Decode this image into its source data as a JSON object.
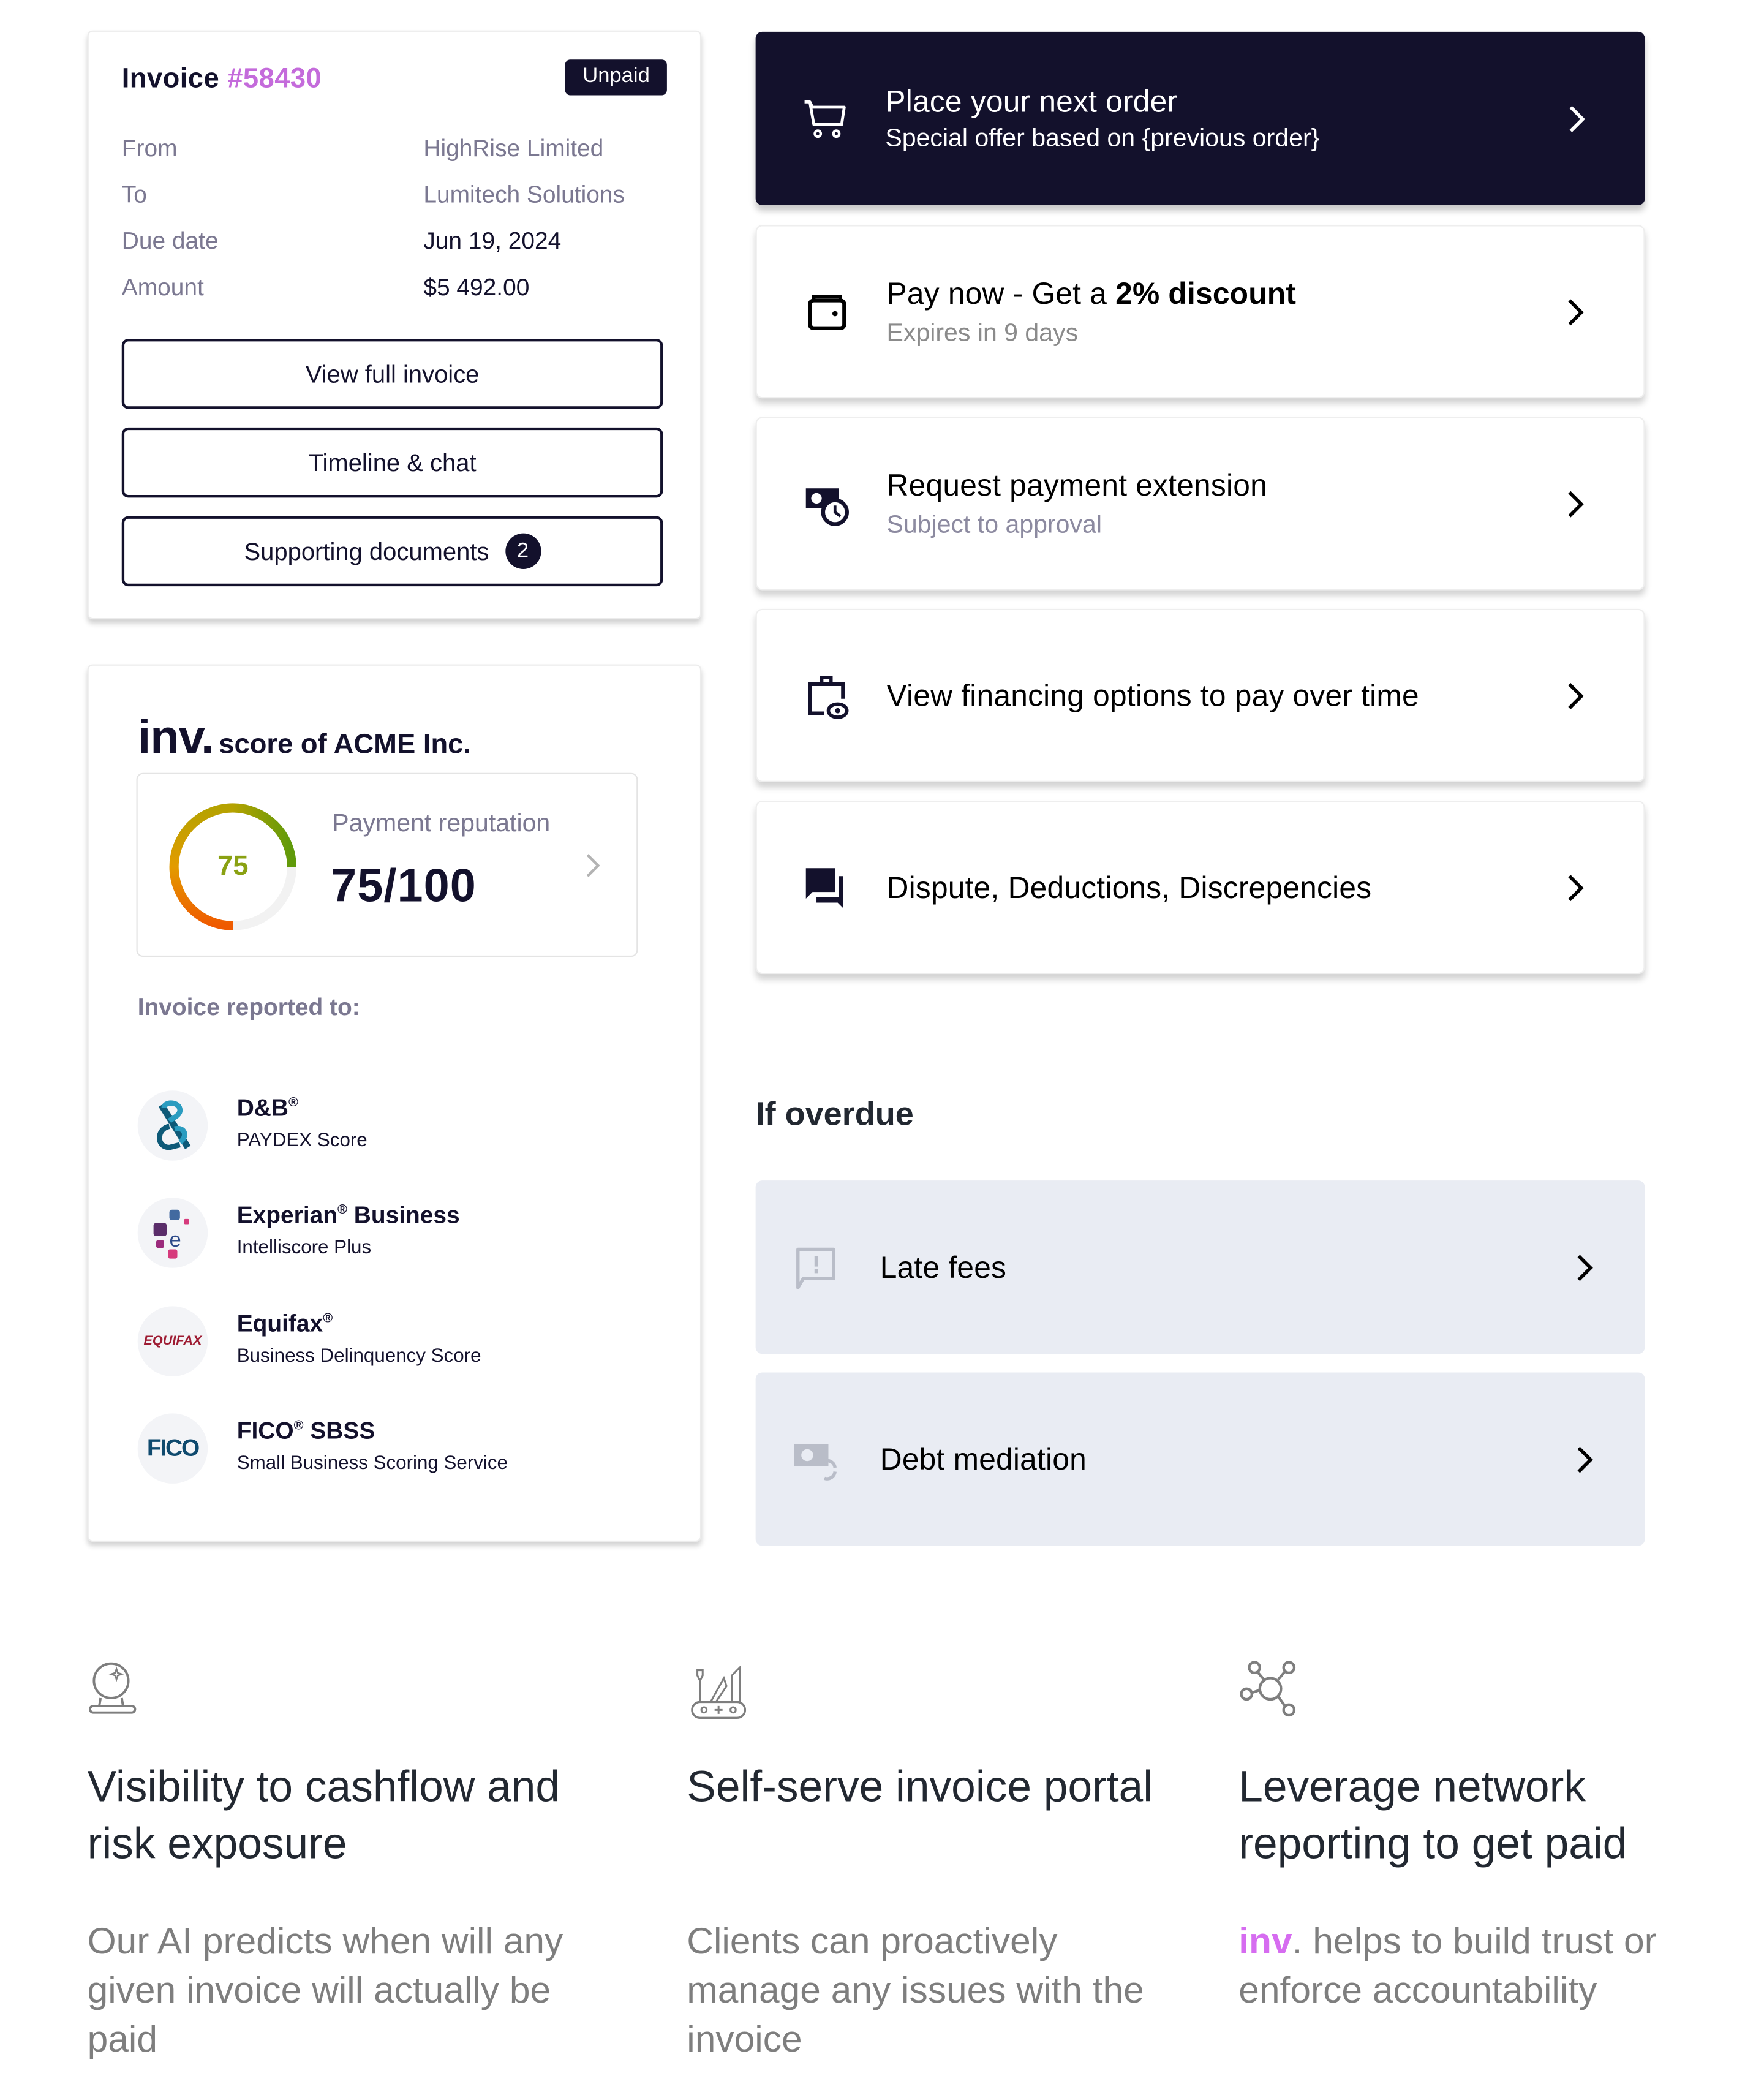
{
  "invoice": {
    "title_prefix": "Invoice",
    "number": "#58430",
    "status": "Unpaid",
    "fields": [
      {
        "label": "From",
        "value": "HighRise Limited"
      },
      {
        "label": "To",
        "value": "Lumitech Solutions"
      },
      {
        "label": "Due date",
        "value": "Jun 19, 2024"
      },
      {
        "label": "Amount",
        "value": "$5 492.00"
      }
    ],
    "buttons": {
      "view_full": "View full invoice",
      "timeline": "Timeline & chat",
      "supporting_docs": "Supporting documents",
      "supporting_docs_count": "2"
    },
    "colors": {
      "number": "#c46bdb",
      "dark": "#13112c"
    }
  },
  "score": {
    "brand": "inv.",
    "heading_rest": "score of ACME Inc.",
    "reputation_label": "Payment reputation",
    "score_value": 75,
    "score_max": 100,
    "score_display": "75/100",
    "gauge_number": "75",
    "reported_label": "Invoice reported to:",
    "bureaus": [
      {
        "name": "D&B",
        "reg": "®",
        "subtitle": "PAYDEX Score",
        "logo": "dnb-logo"
      },
      {
        "name": "Experian",
        "reg": "®",
        "name_suffix": " Business",
        "subtitle": "Intelliscore Plus",
        "logo": "experian-logo"
      },
      {
        "name": "Equifax",
        "reg": "®",
        "subtitle": "Business Delinquency Score",
        "logo": "equifax-logo",
        "logo_text": "EQUIFAX"
      },
      {
        "name": "FICO",
        "reg": "®",
        "name_suffix": " SBSS",
        "subtitle": "Small Business Scoring Service",
        "logo": "fico-logo",
        "logo_text": "FICO"
      }
    ]
  },
  "actions": [
    {
      "title": "Place your next order",
      "subtitle": "Special offer based on {previous order}",
      "icon": "cart-icon",
      "style": "dark"
    },
    {
      "title_plain": "Pay now - Get a ",
      "title_bold": "2% discount",
      "subtitle": "Expires in 9 days",
      "icon": "wallet-icon",
      "style": "light"
    },
    {
      "title": "Request payment extension",
      "subtitle": "Subject to approval",
      "icon": "money-clock-icon",
      "style": "light"
    },
    {
      "title": "View financing options to pay over time",
      "icon": "briefcase-eye-icon",
      "style": "light"
    },
    {
      "title": "Dispute, Deductions, Discrepencies",
      "icon": "chat-bubbles-icon",
      "style": "light"
    }
  ],
  "overdue": {
    "title": "If overdue",
    "items": [
      {
        "title": "Late fees",
        "icon": "alert-comment-icon"
      },
      {
        "title": "Debt mediation",
        "icon": "money-sync-icon"
      }
    ]
  },
  "features": [
    {
      "icon": "crystal-ball-icon",
      "heading": "Visibility to cashflow and risk exposure",
      "body": "Our AI predicts when will any given invoice will actually be paid"
    },
    {
      "icon": "swiss-knife-icon",
      "heading": "Self-serve invoice portal",
      "body": "Clients can proactively manage any issues with the invoice"
    },
    {
      "icon": "network-icon",
      "heading": "Leverage network reporting to get paid",
      "body_brand": "inv",
      "body": ". helps to build trust or enforce accountability"
    }
  ],
  "colors": {
    "dark_navy": "#13112c",
    "brand_pink": "#d66cf0",
    "muted_card": "#e9ecf3",
    "gauge_green": "#5f9a0a",
    "gauge_orange": "#ef6a00"
  }
}
